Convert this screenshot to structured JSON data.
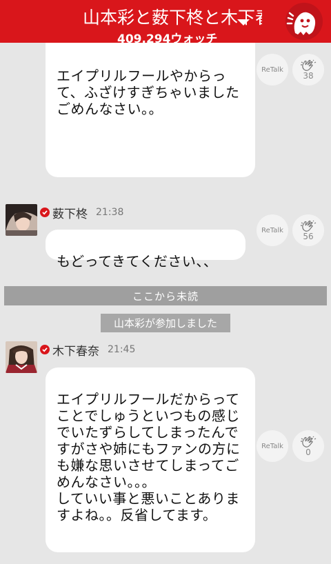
{
  "header": {
    "title": "山本彩と薮下柊と木下春奈",
    "subtitle": "409,294ウォッチ"
  },
  "messages": [
    {
      "text": "エイプリルフールやからって、ふざけすぎちゃいました\nごめんなさい。。",
      "retalk": "ReTalk",
      "claps": "38"
    },
    {
      "name": "薮下柊",
      "time": "21:38",
      "text": "もどってきてください、、",
      "retalk": "ReTalk",
      "claps": "56"
    },
    {
      "name": "木下春奈",
      "time": "21:45",
      "text": "エイプリルフールだからってことでしゅうといつもの感じでいたずらしてしまったんですがさや姉にもファンの方にも嫌な思いさせてしまってごめんなさい。。。\nしていい事と悪いことありますよね。。反省してます。",
      "retalk": "ReTalk",
      "claps": "0"
    }
  ],
  "divider": "ここから未読",
  "system": "山本彩が参加しました",
  "colors": {
    "brand_red": "#d9161b",
    "background": "#e6e6e6",
    "bubble": "#ffffff"
  }
}
